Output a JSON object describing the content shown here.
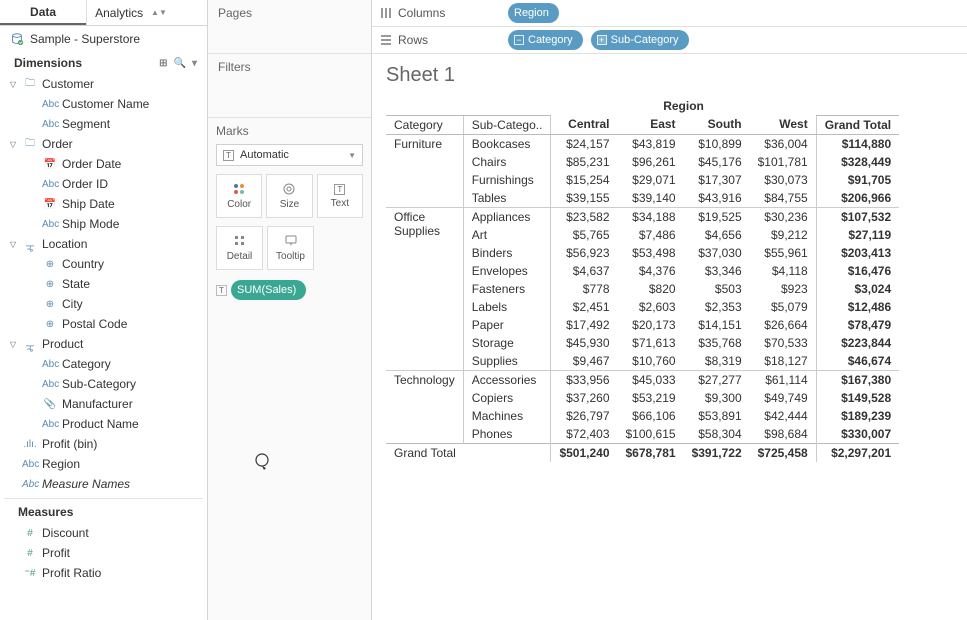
{
  "left": {
    "tab_active": "Data",
    "tab_inactive": "Analytics",
    "datasource": "Sample - Superstore",
    "dimensions_label": "Dimensions",
    "measures_label": "Measures",
    "tree": {
      "customer": "Customer",
      "customer_name": "Customer Name",
      "segment": "Segment",
      "order": "Order",
      "order_date": "Order Date",
      "order_id": "Order ID",
      "ship_date": "Ship Date",
      "ship_mode": "Ship Mode",
      "location": "Location",
      "country": "Country",
      "state": "State",
      "city": "City",
      "postal_code": "Postal Code",
      "product": "Product",
      "category": "Category",
      "sub_category": "Sub-Category",
      "manufacturer": "Manufacturer",
      "product_name": "Product Name",
      "profit_bin": "Profit (bin)",
      "region": "Region",
      "measure_names": "Measure Names",
      "discount": "Discount",
      "profit": "Profit",
      "profit_ratio": "Profit Ratio"
    }
  },
  "mid": {
    "pages": "Pages",
    "filters": "Filters",
    "marks": "Marks",
    "mark_type": "Automatic",
    "btn_color": "Color",
    "btn_size": "Size",
    "btn_text": "Text",
    "btn_detail": "Detail",
    "btn_tooltip": "Tooltip",
    "sum_pill": "SUM(Sales)"
  },
  "shelves": {
    "columns_label": "Columns",
    "rows_label": "Rows",
    "columns_pill": "Region",
    "rows_pill_1": "Category",
    "rows_pill_2": "Sub-Category"
  },
  "sheet": {
    "title": "Sheet 1",
    "region_header": "Region",
    "headers": {
      "category": "Category",
      "subcat": "Sub-Catego..",
      "c": "Central",
      "e": "East",
      "s": "South",
      "w": "West",
      "gt": "Grand Total"
    },
    "grand_total_label": "Grand Total"
  },
  "chart_data": {
    "type": "table",
    "row_dims": [
      "Category",
      "Sub-Category"
    ],
    "col_dim": "Region",
    "columns": [
      "Central",
      "East",
      "South",
      "West",
      "Grand Total"
    ],
    "rows": [
      {
        "category": "Furniture",
        "sub": "Bookcases",
        "v": [
          "$24,157",
          "$43,819",
          "$10,899",
          "$36,004",
          "$114,880"
        ]
      },
      {
        "category": "",
        "sub": "Chairs",
        "v": [
          "$85,231",
          "$96,261",
          "$45,176",
          "$101,781",
          "$328,449"
        ]
      },
      {
        "category": "",
        "sub": "Furnishings",
        "v": [
          "$15,254",
          "$29,071",
          "$17,307",
          "$30,073",
          "$91,705"
        ]
      },
      {
        "category": "",
        "sub": "Tables",
        "v": [
          "$39,155",
          "$39,140",
          "$43,916",
          "$84,755",
          "$206,966"
        ]
      },
      {
        "category": "Office Supplies",
        "sub": "Appliances",
        "v": [
          "$23,582",
          "$34,188",
          "$19,525",
          "$30,236",
          "$107,532"
        ]
      },
      {
        "category": "",
        "sub": "Art",
        "v": [
          "$5,765",
          "$7,486",
          "$4,656",
          "$9,212",
          "$27,119"
        ]
      },
      {
        "category": "",
        "sub": "Binders",
        "v": [
          "$56,923",
          "$53,498",
          "$37,030",
          "$55,961",
          "$203,413"
        ]
      },
      {
        "category": "",
        "sub": "Envelopes",
        "v": [
          "$4,637",
          "$4,376",
          "$3,346",
          "$4,118",
          "$16,476"
        ]
      },
      {
        "category": "",
        "sub": "Fasteners",
        "v": [
          "$778",
          "$820",
          "$503",
          "$923",
          "$3,024"
        ]
      },
      {
        "category": "",
        "sub": "Labels",
        "v": [
          "$2,451",
          "$2,603",
          "$2,353",
          "$5,079",
          "$12,486"
        ]
      },
      {
        "category": "",
        "sub": "Paper",
        "v": [
          "$17,492",
          "$20,173",
          "$14,151",
          "$26,664",
          "$78,479"
        ]
      },
      {
        "category": "",
        "sub": "Storage",
        "v": [
          "$45,930",
          "$71,613",
          "$35,768",
          "$70,533",
          "$223,844"
        ]
      },
      {
        "category": "",
        "sub": "Supplies",
        "v": [
          "$9,467",
          "$10,760",
          "$8,319",
          "$18,127",
          "$46,674"
        ]
      },
      {
        "category": "Technology",
        "sub": "Accessories",
        "v": [
          "$33,956",
          "$45,033",
          "$27,277",
          "$61,114",
          "$167,380"
        ]
      },
      {
        "category": "",
        "sub": "Copiers",
        "v": [
          "$37,260",
          "$53,219",
          "$9,300",
          "$49,749",
          "$149,528"
        ]
      },
      {
        "category": "",
        "sub": "Machines",
        "v": [
          "$26,797",
          "$66,106",
          "$53,891",
          "$42,444",
          "$189,239"
        ]
      },
      {
        "category": "",
        "sub": "Phones",
        "v": [
          "$72,403",
          "$100,615",
          "$58,304",
          "$98,684",
          "$330,007"
        ]
      }
    ],
    "grand_total": [
      "$501,240",
      "$678,781",
      "$391,722",
      "$725,458",
      "$2,297,201"
    ]
  }
}
